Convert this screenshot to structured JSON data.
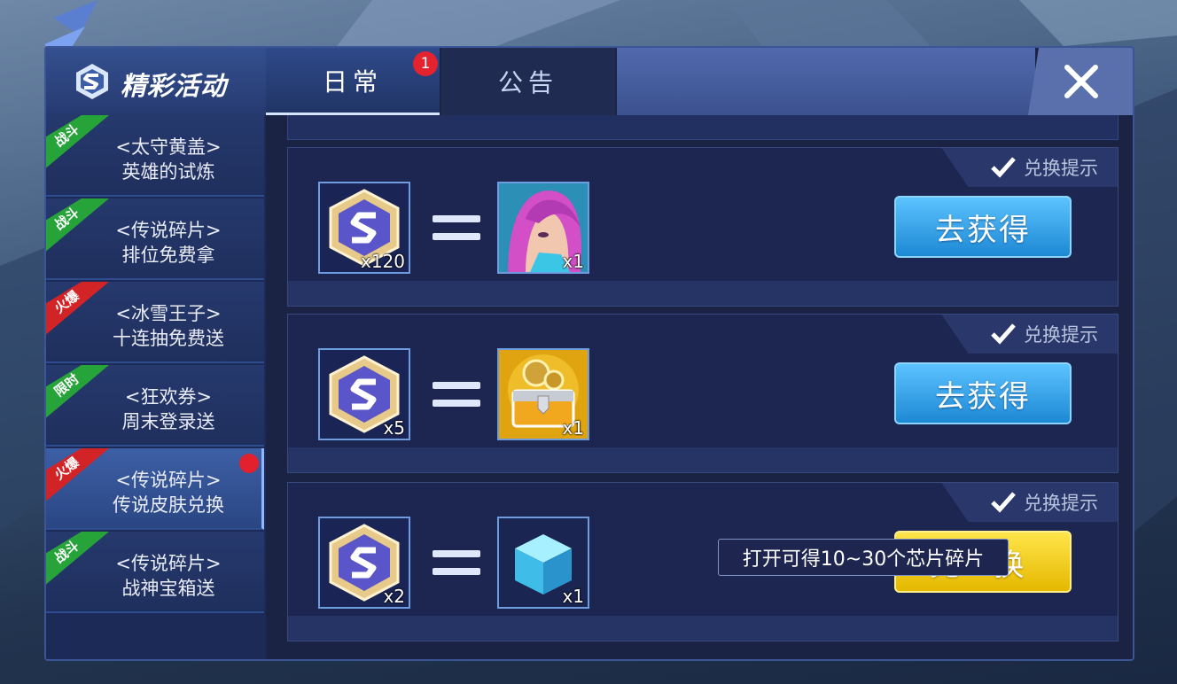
{
  "header": {
    "title": "精彩活动",
    "tabs": [
      {
        "label": "日常",
        "active": true,
        "badge": "1"
      },
      {
        "label": "公告",
        "active": false
      }
    ],
    "close_icon": "close-x-icon"
  },
  "sidebar": {
    "items": [
      {
        "tag": "战斗",
        "tag_color": "#27a439",
        "line1": "<太守黄盖>",
        "line2": "英雄的试炼",
        "active": false
      },
      {
        "tag": "战斗",
        "tag_color": "#27a439",
        "line1": "<传说碎片>",
        "line2": "排位免费拿",
        "active": false
      },
      {
        "tag": "火爆",
        "tag_color": "#d22327",
        "line1": "<冰雪王子>",
        "line2": "十连抽免费送",
        "active": false
      },
      {
        "tag": "限时",
        "tag_color": "#27a439",
        "line1": "<狂欢券>",
        "line2": "周末登录送",
        "active": false
      },
      {
        "tag": "火爆",
        "tag_color": "#d22327",
        "line1": "<传说碎片>",
        "line2": "传说皮肤兑换",
        "active": true,
        "has_dot": true
      },
      {
        "tag": "战斗",
        "tag_color": "#27a439",
        "line1": "<传说碎片>",
        "line2": "战神宝箱送",
        "active": false
      }
    ]
  },
  "exchanges": [
    {
      "hint": "兑换提示",
      "cost_icon": "legend-shard-token-icon",
      "cost_qty": "x120",
      "reward_icon": "hero-skin-portrait-icon",
      "reward_qty": "x1",
      "button": "去获得",
      "button_style": "blue"
    },
    {
      "hint": "兑换提示",
      "cost_icon": "legend-shard-token-icon",
      "cost_qty": "x5",
      "reward_icon": "gold-gear-chest-icon",
      "reward_qty": "x1",
      "button": "去获得",
      "button_style": "blue"
    },
    {
      "hint": "兑换提示",
      "cost_icon": "legend-shard-token-icon",
      "cost_qty": "x2",
      "reward_icon": "chip-cube-icon",
      "reward_qty": "x1",
      "button": "兑 换",
      "button_style": "yellow"
    }
  ],
  "tooltip": "打开可得10~30个芯片碎片",
  "colors": {
    "panel": "#1b2345",
    "accent_blue": "#3b5596",
    "button_blue": "#1d88d4",
    "button_yellow": "#f2c400",
    "badge_red": "#e5232e"
  }
}
